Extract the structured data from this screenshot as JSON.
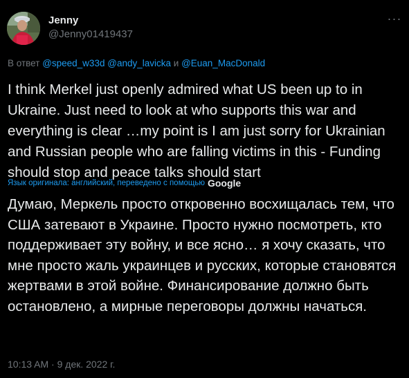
{
  "author": {
    "display_name": "Jenny",
    "handle": "@Jenny01419437"
  },
  "menu_icon": "more-horizontal-icon",
  "reply_context": {
    "prefix": "В ответ",
    "mentions": [
      "@speed_w33d",
      "@andy_lavicka",
      "@Euan_MacDonald"
    ],
    "conjunction": "и"
  },
  "tweet": {
    "original_text": "I think Merkel just openly admired what US been up to in Ukraine. Just need to look at who supports this war and everything is clear …my point is I am just sorry for Ukrainian and Russian people who are falling victims in this - Funding should stop and peace talks should start",
    "translation_note": "Язык оригинала: английский, переведено с помощью",
    "translation_provider": "Google",
    "translated_text": "Думаю, Меркель просто откровенно восхищалась тем, что США затевают в Украине. Просто нужно посмотреть, кто поддерживает эту войну, и все ясно… я хочу сказать, что мне просто жаль украинцев и русских, которые становятся жертвами в этой войне. Финансирование должно быть остановлено, а мирные переговоры должны начаться.",
    "timestamp": "10:13 AM · 9 дек. 2022 г."
  },
  "colors": {
    "background": "#000000",
    "text": "#e7e9ea",
    "muted": "#71767b",
    "link": "#1d9bf0"
  }
}
